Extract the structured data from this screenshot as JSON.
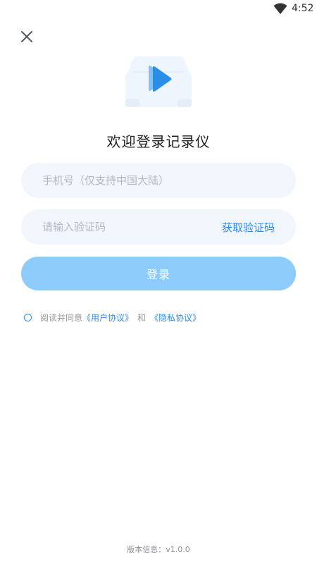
{
  "status_bar": {
    "time": "4:52",
    "wifi_icon": "wifi-icon"
  },
  "close_icon": "close-icon",
  "logo_icon": "car-play-logo-icon",
  "title": "欢迎登录记录仪",
  "phone_input": {
    "placeholder": "手机号（仅支持中国大陆）",
    "value": ""
  },
  "code_input": {
    "placeholder": "请输入验证码",
    "value": "",
    "get_code_label": "获取验证码"
  },
  "login_button": {
    "label": "登录"
  },
  "agreement": {
    "prefix": "阅读并同意",
    "user_agreement": "《用户协议》",
    "conjunction": "和",
    "privacy_agreement": "《隐私协议》",
    "checked": false
  },
  "version": "版本信息：v1.0.0",
  "colors": {
    "accent": "#2c8ae6",
    "login_button": "#8dcbfb",
    "input_background": "#f1f6fd",
    "logo_background": "#eef5fc",
    "logo_play": "#2a8ee9"
  }
}
